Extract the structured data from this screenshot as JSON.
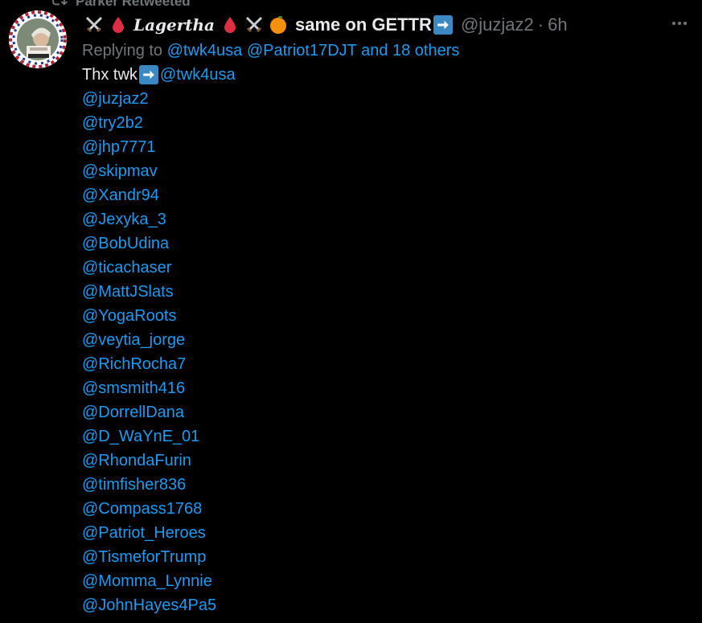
{
  "retweet": {
    "text": "Parker Retweeted"
  },
  "tweet": {
    "author_name_pre": "same on GETTR",
    "author_gothic": "Lagertha",
    "handle": "@juzjaz2",
    "separator": "·",
    "time": "6h",
    "replying_prefix": "Replying to",
    "replying_mentions": [
      "@twk4usa",
      "@Patriot17DJT"
    ],
    "replying_and": "and 18 others",
    "text_start": "Thx twk",
    "text_mention": "@twk4usa",
    "mentions": [
      "@juzjaz2",
      "@try2b2",
      "@jhp7771",
      "@skipmav",
      "@Xandr94",
      "@Jexyka_3",
      "@BobUdina",
      "@ticachaser",
      "@MattJSlats",
      "@YogaRoots",
      "@veytia_jorge",
      "@RichRocha7",
      "@smsmith416",
      "@DorrellDana",
      "@D_WaYnE_01",
      "@RhondaFurin",
      "@timfisher836",
      "@Compass1768",
      "@Patriot_Heroes",
      "@TismeforTrump",
      "@Momma_Lynnie",
      "@JohnHayes4Pa5"
    ]
  },
  "icons": {
    "retweet": "retweet-icon",
    "swords": "crossed-swords-icon",
    "blood": "drop-of-blood-icon",
    "orange": "tangerine-icon",
    "arrow": "right-arrow-icon",
    "more": "more-icon"
  },
  "colors": {
    "background": "#000000",
    "text": "#e7e9ea",
    "muted": "#71767b",
    "link": "#1d9bf0"
  }
}
